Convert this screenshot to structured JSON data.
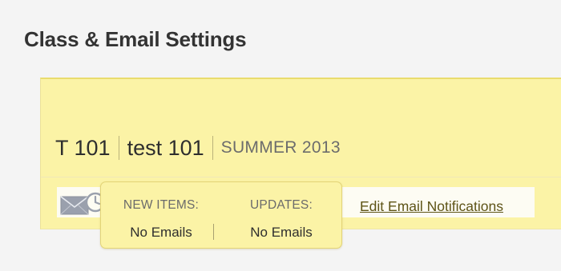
{
  "page": {
    "title": "Class & Email Settings"
  },
  "course": {
    "code": "T 101",
    "name": "test 101",
    "term": "SUMMER 2013"
  },
  "email_settings": {
    "icon": "mail-clock-icon",
    "new_items_label": "NEW ITEMS:",
    "new_items_value": "No Emails",
    "updates_label": "UPDATES:",
    "updates_value": "No Emails",
    "edit_link": "Edit Email Notifications"
  },
  "colors": {
    "panel_bg": "#fbf3a6",
    "panel_border": "#e9dc6d",
    "link": "#5e5417"
  }
}
